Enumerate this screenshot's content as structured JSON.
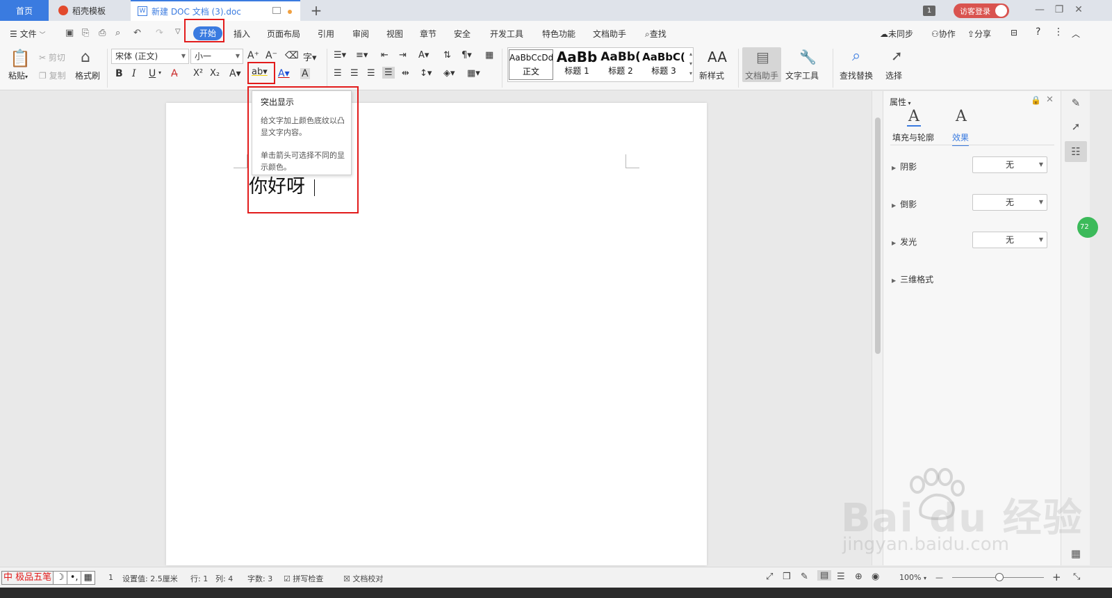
{
  "tabbar": {
    "home": "首页",
    "template": "稻壳模板",
    "doc_title": "新建 DOC 文档 (3).doc",
    "doc_icon": "W",
    "new_tab": "+",
    "window_badge": "1",
    "login": "访客登录",
    "min": "—",
    "restore": "❐",
    "close": "✕"
  },
  "menu": {
    "file": "文件",
    "active_tab": "开始",
    "tabs": [
      "插入",
      "页面布局",
      "引用",
      "审阅",
      "视图",
      "章节",
      "安全",
      "开发工具",
      "特色功能",
      "文档助手"
    ],
    "search": "查找",
    "sync": "未同步",
    "collab": "协作",
    "share": "分享",
    "help": "?",
    "more": "⋮",
    "collapse": "︿"
  },
  "ribbon": {
    "paste": "粘贴",
    "cut": "剪切",
    "copy": "复制",
    "format_painter": "格式刷",
    "font_name": "宋体 (正文)",
    "font_size": "小一",
    "bold": "B",
    "italic": "I",
    "underline": "U",
    "styles": [
      {
        "preview": "AaBbCcDd",
        "name": "正文"
      },
      {
        "preview": "AaBb",
        "name": "标题 1"
      },
      {
        "preview": "AaBb(",
        "name": "标题 2"
      },
      {
        "preview": "AaBbC(",
        "name": "标题 3"
      }
    ],
    "new_style": "新样式",
    "doc_assistant": "文档助手",
    "text_tools": "文字工具",
    "find_replace": "查找替换",
    "select": "选择"
  },
  "tooltip": {
    "title": "突出显示",
    "desc1": "给文字加上颜色底纹以凸显文字内容。",
    "desc2": "单击箭头可选择不同的显示颜色。"
  },
  "document": {
    "text": "你好呀"
  },
  "panel": {
    "title": "属性",
    "tab_fill": "填充与轮廓",
    "tab_effect": "效果",
    "glyph": "A",
    "rows": [
      {
        "label": "阴影",
        "value": "无"
      },
      {
        "label": "倒影",
        "value": "无"
      },
      {
        "label": "发光",
        "value": "无"
      },
      {
        "label": "三维格式",
        "value": ""
      }
    ],
    "green_badge": "72"
  },
  "watermark": {
    "brand": "Bai du 经验",
    "url": "jingyan.baidu.com"
  },
  "status": {
    "ime_brand": "中 极品五笔",
    "page_no": "1",
    "setting": "设置值: 2.5厘米",
    "row": "行: 1",
    "col": "列: 4",
    "words": "字数: 3",
    "spell": "拼写检查",
    "proof": "文档校对",
    "zoom": "100%",
    "zoom_minus": "—",
    "zoom_plus": "+"
  },
  "colors": {
    "accent": "#3a7be0",
    "highlight_box": "#e21b1b",
    "login": "#d9534f"
  }
}
